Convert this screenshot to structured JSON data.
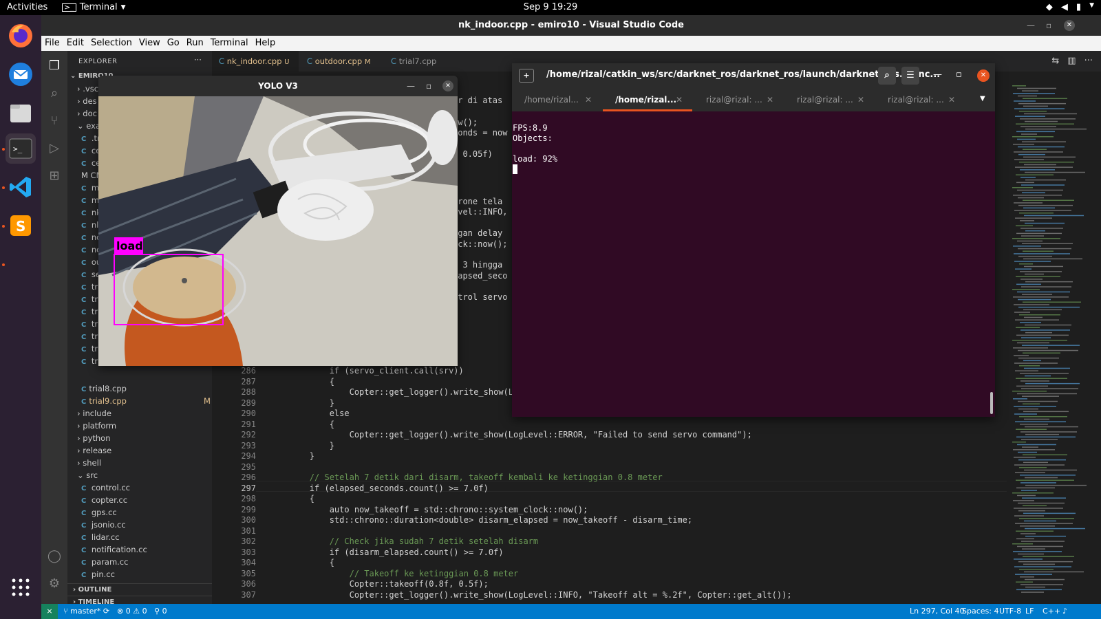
{
  "topbar": {
    "activities": "Activities",
    "app": "Terminal",
    "clock": "Sep 9  19:29"
  },
  "vscode": {
    "title": "nk_indoor.cpp - emiro10 - Visual Studio Code",
    "menu": [
      "File",
      "Edit",
      "Selection",
      "View",
      "Go",
      "Run",
      "Terminal",
      "Help"
    ],
    "explorer_title": "EXPLORER",
    "root_folder": "EMIRO10",
    "tree_top": [
      ".vsc",
      "des",
      "doc",
      "exa",
      ".tr",
      "ce",
      "ce",
      "CM",
      "mi",
      "mi",
      "nk",
      "nl",
      "nc",
      "nc",
      "ou",
      "se",
      "tri",
      "tri",
      "tri",
      "tri",
      "tri",
      "tri",
      "tri"
    ],
    "tree_files": [
      {
        "name": "trial8.cpp",
        "kind": "cpp",
        "mod": ""
      },
      {
        "name": "trial9.cpp",
        "kind": "cpp",
        "mod": "M"
      }
    ],
    "tree_folders": [
      "include",
      "platform",
      "python",
      "release",
      "shell",
      "src"
    ],
    "src_files": [
      "control.cc",
      "copter.cc",
      "gps.cc",
      "jsonio.cc",
      "lidar.cc",
      "notification.cc",
      "param.cc",
      "pin.cc"
    ],
    "outline": "OUTLINE",
    "timeline": "TIMELINE",
    "tabs": [
      {
        "label": "nk_indoor.cpp",
        "badge": "U"
      },
      {
        "label": "outdoor.cpp",
        "badge": "M"
      },
      {
        "label": "trial7.cpp",
        "badge": ""
      }
    ],
    "code_partial": [
      "er di atas",
      "ow();",
      "conds = now",
      "< 0.05f)",
      "drone tela",
      "evel::INFO,",
      "ngan delay",
      "ock::now();",
      "a 3 hingga",
      "lapsed_seco",
      "ntrol servo"
    ],
    "lines": [
      {
        "n": "286",
        "t": "            if (servo_client.call(srv))"
      },
      {
        "n": "287",
        "t": "            {"
      },
      {
        "n": "288",
        "t": "                Copter::get_logger().write_show(LogLevel::I"
      },
      {
        "n": "289",
        "t": "            }"
      },
      {
        "n": "290",
        "t": "            else"
      },
      {
        "n": "291",
        "t": "            {"
      },
      {
        "n": "292",
        "t": "                Copter::get_logger().write_show(LogLevel::ERROR, \"Failed to send servo command\");"
      },
      {
        "n": "293",
        "t": "            }"
      },
      {
        "n": "294",
        "t": "        }"
      },
      {
        "n": "295",
        "t": ""
      },
      {
        "n": "296",
        "t": "        // Setelah 7 detik dari disarm, takeoff kembali ke ketinggian 0.8 meter"
      },
      {
        "n": "297",
        "t": "        if (elapsed_seconds.count() >= 7.0f)"
      },
      {
        "n": "298",
        "t": "        {"
      },
      {
        "n": "299",
        "t": "            auto now_takeoff = std::chrono::system_clock::now();"
      },
      {
        "n": "300",
        "t": "            std::chrono::duration<double> disarm_elapsed = now_takeoff - disarm_time;"
      },
      {
        "n": "301",
        "t": ""
      },
      {
        "n": "302",
        "t": "            // Check jika sudah 7 detik setelah disarm"
      },
      {
        "n": "303",
        "t": "            if (disarm_elapsed.count() >= 7.0f)"
      },
      {
        "n": "304",
        "t": "            {"
      },
      {
        "n": "305",
        "t": "                // Takeoff ke ketinggian 0.8 meter"
      },
      {
        "n": "306",
        "t": "                Copter::takeoff(0.8f, 0.5f);"
      },
      {
        "n": "307",
        "t": "                Copter::get_logger().write_show(LogLevel::INFO, \"Takeoff alt = %.2f\", Copter::get_alt());"
      }
    ],
    "status": {
      "branch": "master*",
      "errors": "0",
      "warnings": "0",
      "ports": "0",
      "position": "Ln 297, Col 40",
      "spaces": "Spaces: 4",
      "encoding": "UTF-8",
      "eol": "LF",
      "language": "C++"
    }
  },
  "yolo": {
    "title": "YOLO V3",
    "detection_label": "load",
    "box_color": "#ff00ff"
  },
  "terminal": {
    "title": "/home/rizal/catkin_ws/src/darknet_ros/darknet_ros/launch/darknet_ros.launc...",
    "tabs": [
      "/home/rizal...",
      "/home/rizal...",
      "rizal@rizal: ...",
      "rizal@rizal: ...",
      "rizal@rizal: ..."
    ],
    "output": [
      "FPS:8.9",
      "Objects:",
      "",
      "load: 92%"
    ]
  },
  "colors": {
    "accent": "#e95420",
    "vscode_status": "#007acc",
    "terminal_bg": "#300a24"
  }
}
